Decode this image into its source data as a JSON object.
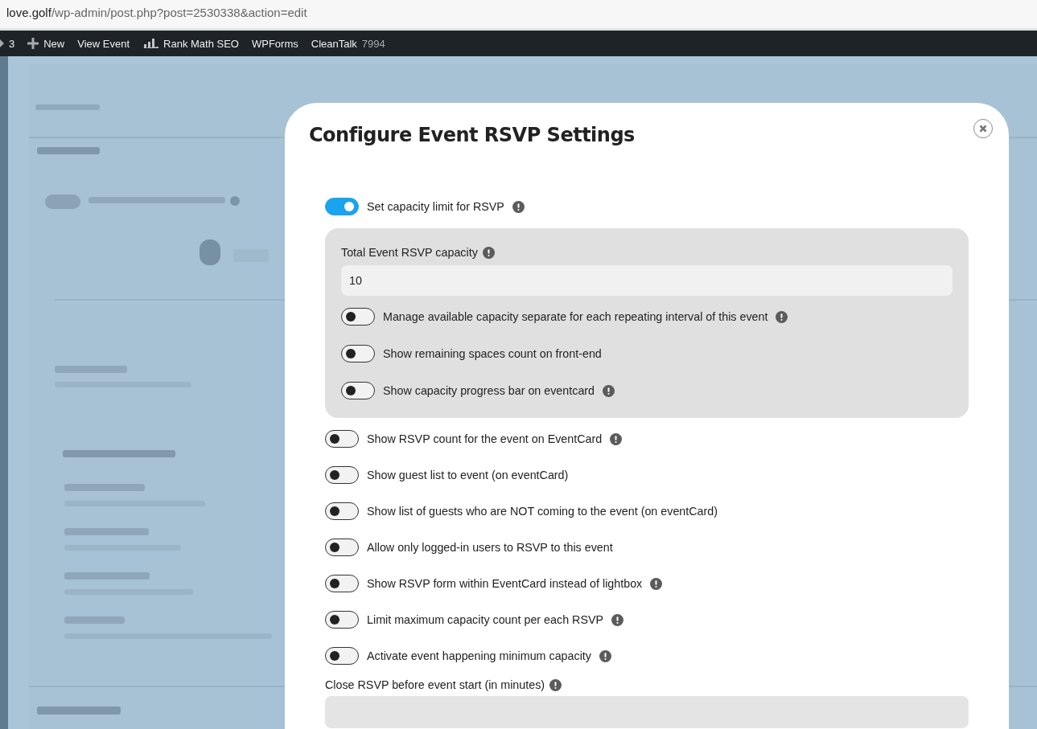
{
  "browser": {
    "url_host": "love.golf",
    "url_path": "/wp-admin/post.php?post=2530338&action=edit"
  },
  "admin_bar": [
    {
      "kind": "partial",
      "label": "3"
    },
    {
      "kind": "plus",
      "label": "New"
    },
    {
      "kind": "plain",
      "label": "View Event"
    },
    {
      "kind": "chart",
      "label": "Rank Math SEO"
    },
    {
      "kind": "plain",
      "label": "WPForms"
    },
    {
      "kind": "plain",
      "label": "CleanTalk",
      "count": "7994"
    }
  ],
  "modal": {
    "title": "Configure Event RSVP Settings",
    "capacity_toggle": {
      "label": "Set capacity limit for RSVP",
      "on": true,
      "info": true
    },
    "capacity_panel": {
      "field_label": "Total Event RSVP capacity",
      "field_info": true,
      "field_value": "10",
      "toggles": [
        {
          "label": "Manage available capacity separate for each repeating interval of this event",
          "on": false,
          "info": true
        },
        {
          "label": "Show remaining spaces count on front-end",
          "on": false,
          "info": false
        },
        {
          "label": "Show capacity progress bar on eventcard",
          "on": false,
          "info": true
        }
      ]
    },
    "toggles": [
      {
        "label": "Show RSVP count for the event on EventCard",
        "on": false,
        "info": true
      },
      {
        "label": "Show guest list to event (on eventCard)",
        "on": false,
        "info": false
      },
      {
        "label": "Show list of guests who are NOT coming to the event (on eventCard)",
        "on": false,
        "info": false
      },
      {
        "label": "Allow only logged-in users to RSVP to this event",
        "on": false,
        "info": false
      },
      {
        "label": "Show RSVP form within EventCard instead of lightbox",
        "on": false,
        "info": true
      },
      {
        "label": "Limit maximum capacity count per each RSVP",
        "on": false,
        "info": true
      },
      {
        "label": "Activate event happening minimum capacity",
        "on": false,
        "info": true
      }
    ],
    "close_field": {
      "label": "Close RSVP before event start (in minutes)",
      "info": true
    }
  }
}
